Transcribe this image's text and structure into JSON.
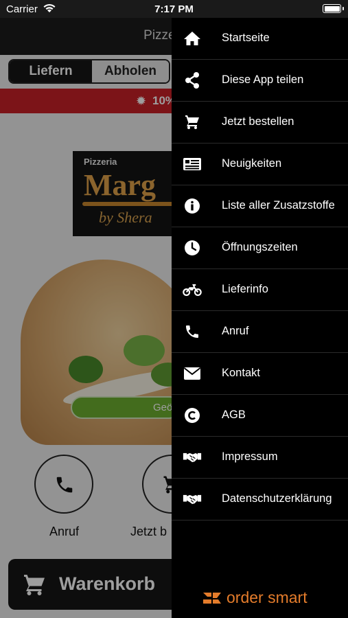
{
  "status_bar": {
    "carrier": "Carrier",
    "time": "7:17 PM"
  },
  "header": {
    "title": "Pizzeria M"
  },
  "order_mode": {
    "options": [
      "Liefern",
      "Abholen"
    ],
    "selected": "Liefern"
  },
  "promo_banner": {
    "text": "10%",
    "color": "#c92128"
  },
  "logo": {
    "line1": "Pizzeria",
    "line2": "Marg",
    "line3": "by Shera"
  },
  "hero": {
    "pill_text": "Geö"
  },
  "actions": [
    {
      "label": "Anruf",
      "icon": "phone-icon"
    },
    {
      "label": "Jetzt b",
      "icon": "cart-icon"
    }
  ],
  "cart": {
    "label": "Warenkorb",
    "icon": "cart-icon"
  },
  "drawer": {
    "items": [
      {
        "label": "Startseite",
        "icon": "home-icon"
      },
      {
        "label": "Diese App teilen",
        "icon": "share-icon"
      },
      {
        "label": "Jetzt bestellen",
        "icon": "cart-icon"
      },
      {
        "label": "Neuigkeiten",
        "icon": "news-icon"
      },
      {
        "label": "Liste aller Zusatzstoffe",
        "icon": "info-icon"
      },
      {
        "label": "Öffnungszeiten",
        "icon": "clock-icon"
      },
      {
        "label": "Lieferinfo",
        "icon": "motorcycle-icon"
      },
      {
        "label": "Anruf",
        "icon": "phone-icon"
      },
      {
        "label": "Kontakt",
        "icon": "mail-icon"
      },
      {
        "label": "AGB",
        "icon": "copyright-icon"
      },
      {
        "label": "Impressum",
        "icon": "handshake-icon"
      },
      {
        "label": "Datenschutzerklärung",
        "icon": "handshake-icon"
      }
    ],
    "brand": "order smart",
    "brand_color": "#e47c2b"
  }
}
